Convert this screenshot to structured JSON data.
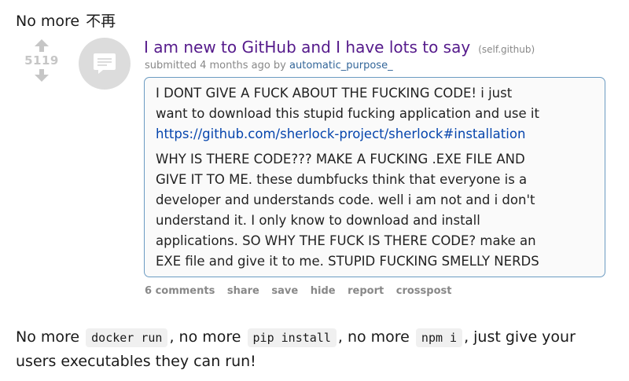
{
  "caption": {
    "en": "No more",
    "cjk": "不再"
  },
  "vote": {
    "score": "5119",
    "upvote_icon": "arrow-up-icon",
    "downvote_icon": "arrow-down-icon"
  },
  "thumbnail": {
    "icon": "self-post-icon"
  },
  "post": {
    "title": "I am new to GitHub and I have lots to say",
    "domain": "(self.github)",
    "submitted_prefix": "submitted 4 months ago by",
    "author": "automatic_purpose_",
    "body_line1": "I DONT GIVE A FUCK ABOUT THE FUCKING CODE! i just",
    "body_line2": "want to download this stupid fucking application and use it",
    "body_link": "https://github.com/sherlock-project/sherlock#installation",
    "body_line4": "WHY IS THERE CODE??? MAKE A FUCKING .EXE FILE AND",
    "body_line5": "GIVE IT TO ME. these dumbfucks think that everyone is a",
    "body_line6": "developer and understands code. well i am not and i don't",
    "body_line7": "understand it. I only know to download and install",
    "body_line8": "applications. SO WHY THE FUCK IS THERE CODE? make an",
    "body_line9": "EXE file and give it to me. STUPID FUCKING SMELLY NERDS"
  },
  "buttons": {
    "comments": "6 comments",
    "share": "share",
    "save": "save",
    "hide": "hide",
    "report": "report",
    "crosspost": "crosspost"
  },
  "bottom": {
    "t1": "No more",
    "code1": "docker run",
    "t2": ", no more",
    "code2": "pip install",
    "t3": ", no more",
    "code3": "npm i",
    "t4": ", just give your users executables they can run!"
  },
  "colors": {
    "title": "#551a8b",
    "link": "#0645ad",
    "author": "#336699",
    "border": "#6b9bc2",
    "muted": "#888888"
  }
}
